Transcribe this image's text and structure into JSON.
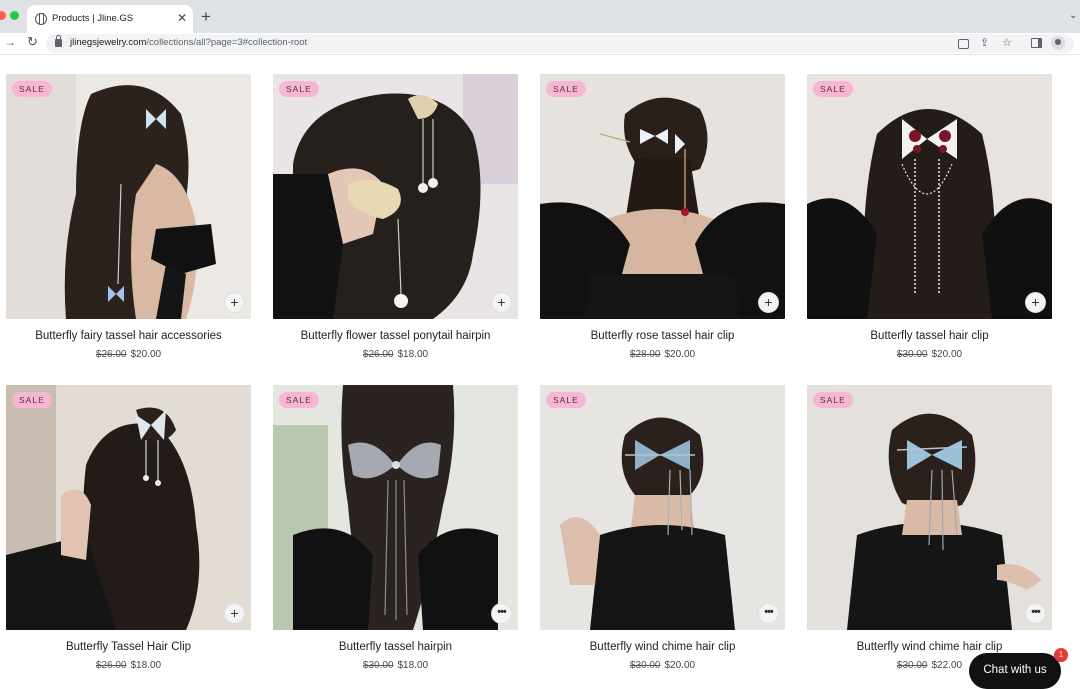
{
  "browser": {
    "tab_title": "Products | Jline.GS",
    "url_domain": "jlinegsjewelry.com",
    "url_path": "/collections/all?page=3#collection-root"
  },
  "products": [
    {
      "badge": "SALE",
      "name": "Butterfly fairy tassel hair accessories",
      "old_price": "$26.00",
      "price": "$20.00",
      "action": "+"
    },
    {
      "badge": "SALE",
      "name": "Butterfly flower tassel ponytail hairpin",
      "old_price": "$26.00",
      "price": "$18.00",
      "action": "+"
    },
    {
      "badge": "SALE",
      "name": "Butterfly rose tassel hair clip",
      "old_price": "$28.00",
      "price": "$20.00",
      "action": "+"
    },
    {
      "badge": "SALE",
      "name": "Butterfly tassel hair clip",
      "old_price": "$30.00",
      "price": "$20.00",
      "action": "+"
    },
    {
      "badge": "SALE",
      "name": "Butterfly Tassel Hair Clip",
      "old_price": "$26.00",
      "price": "$18.00",
      "action": "+"
    },
    {
      "badge": "SALE",
      "name": "Butterfly tassel hairpin",
      "old_price": "$30.00",
      "price": "$18.00",
      "action": "•••"
    },
    {
      "badge": "SALE",
      "name": "Butterfly wind chime hair clip",
      "old_price": "$30.00",
      "price": "$20.00",
      "action": "•••"
    },
    {
      "badge": "SALE",
      "name": "Butterfly wind chime hair clip",
      "old_price": "$30.00",
      "price": "$22.00",
      "action": "•••"
    }
  ],
  "chat": {
    "label": "Chat with us",
    "badge_count": "1"
  }
}
